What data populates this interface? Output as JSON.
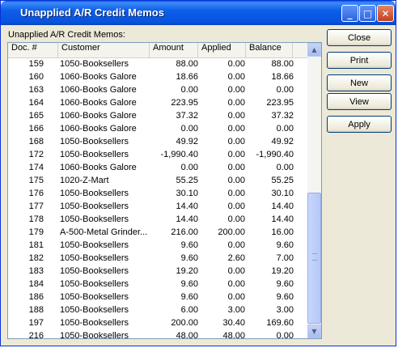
{
  "window": {
    "title": "Unapplied A/R Credit Memos"
  },
  "list_label": "Unapplied A/R Credit Memos:",
  "columns": [
    "Doc. #",
    "Customer",
    "Amount",
    "Applied",
    "Balance"
  ],
  "rows": [
    {
      "doc": "159",
      "customer": "1050-Booksellers",
      "amount": "88.00",
      "applied": "0.00",
      "balance": "88.00"
    },
    {
      "doc": "160",
      "customer": "1060-Books Galore",
      "amount": "18.66",
      "applied": "0.00",
      "balance": "18.66"
    },
    {
      "doc": "163",
      "customer": "1060-Books Galore",
      "amount": "0.00",
      "applied": "0.00",
      "balance": "0.00"
    },
    {
      "doc": "164",
      "customer": "1060-Books Galore",
      "amount": "223.95",
      "applied": "0.00",
      "balance": "223.95"
    },
    {
      "doc": "165",
      "customer": "1060-Books Galore",
      "amount": "37.32",
      "applied": "0.00",
      "balance": "37.32"
    },
    {
      "doc": "166",
      "customer": "1060-Books Galore",
      "amount": "0.00",
      "applied": "0.00",
      "balance": "0.00"
    },
    {
      "doc": "168",
      "customer": "1050-Booksellers",
      "amount": "49.92",
      "applied": "0.00",
      "balance": "49.92"
    },
    {
      "doc": "172",
      "customer": "1050-Booksellers",
      "amount": "-1,990.40",
      "applied": "0.00",
      "balance": "-1,990.40"
    },
    {
      "doc": "174",
      "customer": "1060-Books Galore",
      "amount": "0.00",
      "applied": "0.00",
      "balance": "0.00"
    },
    {
      "doc": "175",
      "customer": "1020-Z-Mart",
      "amount": "55.25",
      "applied": "0.00",
      "balance": "55.25"
    },
    {
      "doc": "176",
      "customer": "1050-Booksellers",
      "amount": "30.10",
      "applied": "0.00",
      "balance": "30.10"
    },
    {
      "doc": "177",
      "customer": "1050-Booksellers",
      "amount": "14.40",
      "applied": "0.00",
      "balance": "14.40"
    },
    {
      "doc": "178",
      "customer": "1050-Booksellers",
      "amount": "14.40",
      "applied": "0.00",
      "balance": "14.40"
    },
    {
      "doc": "179",
      "customer": "A-500-Metal Grinder...",
      "amount": "216.00",
      "applied": "200.00",
      "balance": "16.00"
    },
    {
      "doc": "181",
      "customer": "1050-Booksellers",
      "amount": "9.60",
      "applied": "0.00",
      "balance": "9.60"
    },
    {
      "doc": "182",
      "customer": "1050-Booksellers",
      "amount": "9.60",
      "applied": "2.60",
      "balance": "7.00"
    },
    {
      "doc": "183",
      "customer": "1050-Booksellers",
      "amount": "19.20",
      "applied": "0.00",
      "balance": "19.20"
    },
    {
      "doc": "184",
      "customer": "1050-Booksellers",
      "amount": "9.60",
      "applied": "0.00",
      "balance": "9.60"
    },
    {
      "doc": "186",
      "customer": "1050-Booksellers",
      "amount": "9.60",
      "applied": "0.00",
      "balance": "9.60"
    },
    {
      "doc": "188",
      "customer": "1050-Booksellers",
      "amount": "6.00",
      "applied": "3.00",
      "balance": "3.00"
    },
    {
      "doc": "197",
      "customer": "1050-Booksellers",
      "amount": "200.00",
      "applied": "30.40",
      "balance": "169.60"
    },
    {
      "doc": "216",
      "customer": "1050-Booksellers",
      "amount": "48.00",
      "applied": "48.00",
      "balance": "0.00"
    }
  ],
  "buttons": {
    "close": "Close",
    "print": "Print",
    "new": "New",
    "view": "View",
    "apply": "Apply"
  },
  "colors": {
    "titlebar": "#0a5ee4",
    "window_bg": "#ece9d8",
    "border": "#0831d9"
  }
}
